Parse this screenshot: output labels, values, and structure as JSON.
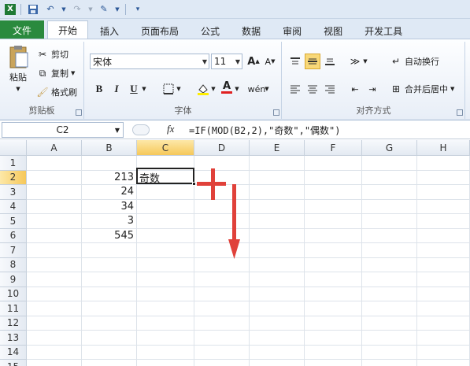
{
  "quick_access": {
    "items": [
      "excel-icon",
      "save-icon",
      "undo-icon",
      "redo-icon",
      "tool-icon",
      "customize-icon"
    ]
  },
  "tabs": [
    {
      "label": "文件",
      "key": "file"
    },
    {
      "label": "开始",
      "key": "home"
    },
    {
      "label": "插入",
      "key": "insert"
    },
    {
      "label": "页面布局",
      "key": "layout"
    },
    {
      "label": "公式",
      "key": "formulas"
    },
    {
      "label": "数据",
      "key": "data"
    },
    {
      "label": "审阅",
      "key": "review"
    },
    {
      "label": "视图",
      "key": "view"
    },
    {
      "label": "开发工具",
      "key": "developer"
    }
  ],
  "active_tab": "开始",
  "ribbon": {
    "clipboard": {
      "paste": "粘贴",
      "cut": "剪切",
      "copy": "复制",
      "format_painter": "格式刷",
      "group_label": "剪贴板"
    },
    "font": {
      "font_name": "宋体",
      "font_size": "11",
      "bold": "B",
      "italic": "I",
      "underline": "U",
      "group_label": "字体"
    },
    "alignment": {
      "wrap": "自动换行",
      "merge": "合并后居中",
      "group_label": "对齐方式"
    }
  },
  "formula_bar": {
    "name_box": "C2",
    "fx": "fx",
    "formula": "=IF(MOD(B2,2),\"奇数\",\"偶数\")"
  },
  "columns": [
    "A",
    "B",
    "C",
    "D",
    "E",
    "F",
    "G",
    "H"
  ],
  "rows": [
    "1",
    "2",
    "3",
    "4",
    "5",
    "6",
    "7",
    "8",
    "9",
    "10",
    "11",
    "12",
    "13",
    "14",
    "15"
  ],
  "cells": {
    "B2": "213",
    "C2": "奇数",
    "B3": "24",
    "B4": "34",
    "B5": "3",
    "B6": "545"
  },
  "selected_cell": "C2",
  "colors": {
    "file_tab": "#2a8a3e",
    "annotation_red": "#e0413a",
    "ribbon_bg": "#dfe9f5"
  }
}
